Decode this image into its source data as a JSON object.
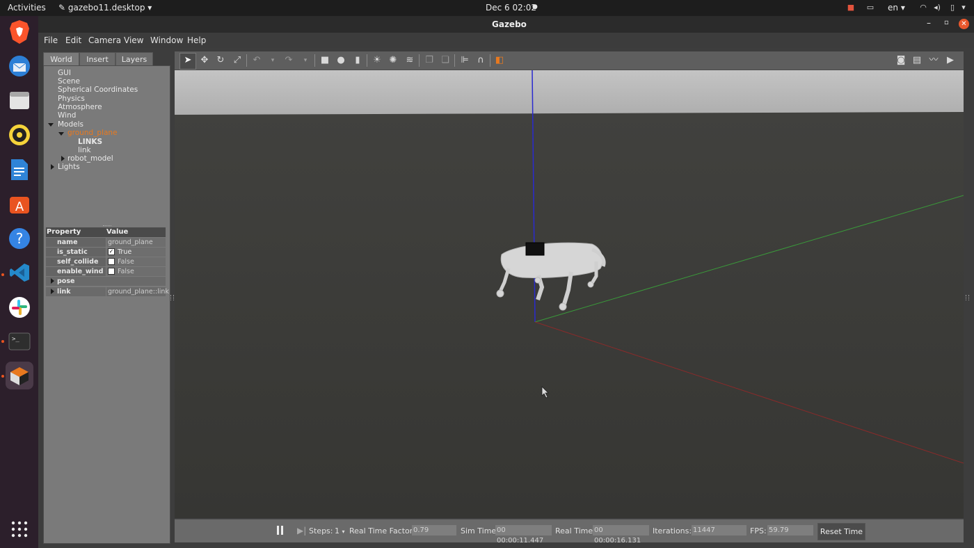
{
  "topbar": {
    "activities": "Activities",
    "app_name": "gazebo11.desktop",
    "clock": "Dec 6  02:02",
    "lang": "en"
  },
  "window": {
    "title": "Gazebo"
  },
  "menu": [
    "File",
    "Edit",
    "Camera",
    "View",
    "Window",
    "Help"
  ],
  "left_panel": {
    "tabs": [
      "World",
      "Insert",
      "Layers"
    ],
    "tree": {
      "gui": "GUI",
      "scene": "Scene",
      "spherical": "Spherical Coordinates",
      "physics": "Physics",
      "atmosphere": "Atmosphere",
      "wind": "Wind",
      "models": "Models",
      "ground_plane": "ground_plane",
      "links": "LINKS",
      "link": "link",
      "robot_model": "robot_model",
      "lights": "Lights"
    },
    "properties": {
      "header_property": "Property",
      "header_value": "Value",
      "rows": [
        {
          "key": "name",
          "value": "ground_plane"
        },
        {
          "key": "is_static",
          "value": "True"
        },
        {
          "key": "self_collide",
          "value": "False"
        },
        {
          "key": "enable_wind",
          "value": "False"
        },
        {
          "key": "pose",
          "value": ""
        },
        {
          "key": "link",
          "value": "ground_plane::link"
        }
      ]
    }
  },
  "bottom": {
    "steps_label": "Steps:",
    "steps_value": "1",
    "rtf_label": "Real Time Factor:",
    "rtf_value": "0.79",
    "sim_label": "Sim Time:",
    "sim_value": "00 00:00:11.447",
    "real_label": "Real Time:",
    "real_value": "00 00:00:16.131",
    "iter_label": "Iterations:",
    "iter_value": "11447",
    "fps_label": "FPS:",
    "fps_value": "59.79",
    "reset_label": "Reset Time"
  },
  "colors": {
    "accent_orange": "#e8791f",
    "axis_x": "#8a2a2a",
    "axis_y": "#3a9a3a",
    "axis_z": "#2a2ad0",
    "sky": "#b8b8b8",
    "ground": "#3a3a37"
  }
}
